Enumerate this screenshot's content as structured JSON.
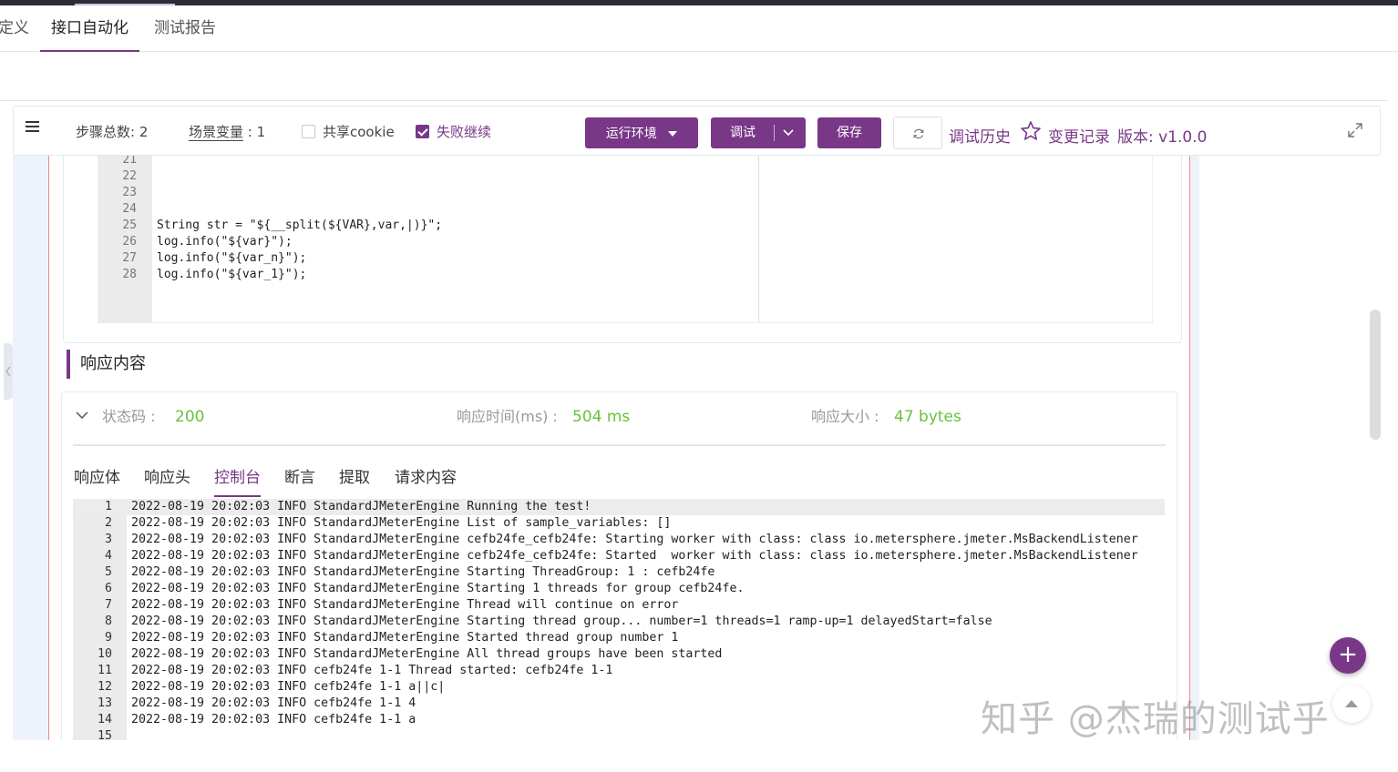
{
  "nav": {
    "tabs": [
      {
        "label": "定义"
      },
      {
        "label": "接口自动化"
      },
      {
        "label": "测试报告"
      }
    ]
  },
  "toolbar": {
    "steps_label": "步骤总数",
    "steps_count": "2",
    "scene_var_label": "场景变量",
    "scene_var_count": "1",
    "share_cookie_label": "共享cookie",
    "share_cookie_checked": false,
    "fail_continue_label": "失败继续",
    "fail_continue_checked": true,
    "env_button": "运行环境",
    "debug_button": "调试",
    "save_button": "保存",
    "debug_history": "调试历史",
    "change_record": "变更记录",
    "version": "版本: v1.0.0"
  },
  "editor": {
    "lines": [
      {
        "no": "21",
        "code": ""
      },
      {
        "no": "22",
        "code": ""
      },
      {
        "no": "23",
        "code": ""
      },
      {
        "no": "24",
        "code": ""
      },
      {
        "no": "25",
        "code": "String str = \"${__split(${VAR},var,|)}\";"
      },
      {
        "no": "26",
        "code": "log.info(\"${var}\");"
      },
      {
        "no": "27",
        "code": "log.info(\"${var_n}\");"
      },
      {
        "no": "28",
        "code": "log.info(\"${var_1}\");"
      }
    ]
  },
  "response": {
    "title": "响应内容",
    "status_label": "状态码 :",
    "status_value": "200",
    "time_label": "响应时间(ms) :",
    "time_value": "504 ms",
    "size_label": "响应大小 :",
    "size_value": "47 bytes",
    "tabs": [
      {
        "label": "响应体"
      },
      {
        "label": "响应头"
      },
      {
        "label": "控制台"
      },
      {
        "label": "断言"
      },
      {
        "label": "提取"
      },
      {
        "label": "请求内容"
      }
    ],
    "active_tab": "控制台"
  },
  "console": {
    "lines": [
      {
        "no": "1",
        "text": "2022-08-19 20:02:03 INFO StandardJMeterEngine Running the test!"
      },
      {
        "no": "2",
        "text": "2022-08-19 20:02:03 INFO StandardJMeterEngine List of sample_variables: []"
      },
      {
        "no": "3",
        "text": "2022-08-19 20:02:03 INFO StandardJMeterEngine cefb24fe_cefb24fe: Starting worker with class: class io.metersphere.jmeter.MsBackendListener"
      },
      {
        "no": "4",
        "text": "2022-08-19 20:02:03 INFO StandardJMeterEngine cefb24fe_cefb24fe: Started  worker with class: class io.metersphere.jmeter.MsBackendListener"
      },
      {
        "no": "5",
        "text": "2022-08-19 20:02:03 INFO StandardJMeterEngine Starting ThreadGroup: 1 : cefb24fe"
      },
      {
        "no": "6",
        "text": "2022-08-19 20:02:03 INFO StandardJMeterEngine Starting 1 threads for group cefb24fe."
      },
      {
        "no": "7",
        "text": "2022-08-19 20:02:03 INFO StandardJMeterEngine Thread will continue on error"
      },
      {
        "no": "8",
        "text": "2022-08-19 20:02:03 INFO StandardJMeterEngine Starting thread group... number=1 threads=1 ramp-up=1 delayedStart=false"
      },
      {
        "no": "9",
        "text": "2022-08-19 20:02:03 INFO StandardJMeterEngine Started thread group number 1"
      },
      {
        "no": "10",
        "text": "2022-08-19 20:02:03 INFO StandardJMeterEngine All thread groups have been started"
      },
      {
        "no": "11",
        "text": "2022-08-19 20:02:03 INFO cefb24fe 1-1 Thread started: cefb24fe 1-1"
      },
      {
        "no": "12",
        "text": "2022-08-19 20:02:03 INFO cefb24fe 1-1 a||c|"
      },
      {
        "no": "13",
        "text": "2022-08-19 20:02:03 INFO cefb24fe 1-1 4"
      },
      {
        "no": "14",
        "text": "2022-08-19 20:02:03 INFO cefb24fe 1-1 a"
      },
      {
        "no": "15",
        "text": ""
      }
    ]
  },
  "fab": {
    "label": "+"
  },
  "watermark": "知乎 @杰瑞的测试乎",
  "colors": {
    "accent": "#783887",
    "success": "#67c23a",
    "border_alert": "#f08a8a"
  }
}
